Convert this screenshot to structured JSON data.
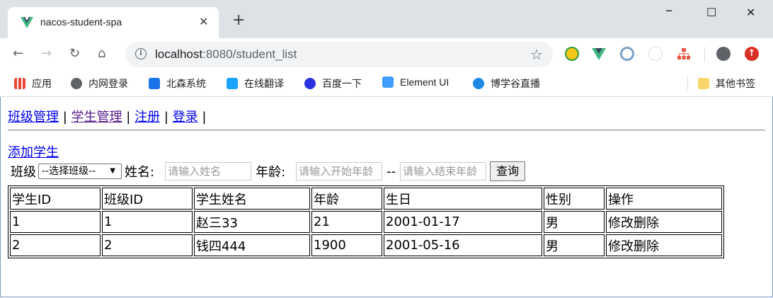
{
  "browser": {
    "tab_title": "nacos-student-spa",
    "url_host": "localhost",
    "url_rest": ":8080/student_list",
    "bookmarks": [
      "应用",
      "内网登录",
      "北森系统",
      "在线翻译",
      "百度一下",
      "Element UI",
      "博学谷直播"
    ],
    "other_bookmarks": "其他书签"
  },
  "nav": {
    "items": [
      "班级管理",
      "学生管理",
      "注册",
      "登录"
    ],
    "sep": "|"
  },
  "add_student": "添加学生",
  "filters": {
    "class_label": "班级",
    "class_select": "--选择班级--",
    "name_label": "姓名:",
    "name_placeholder": "请输入姓名",
    "age_label": "年龄:",
    "age_start_placeholder": "请输入开始年龄",
    "dash": "--",
    "age_end_placeholder": "请输入结束年龄",
    "query_button": "查询"
  },
  "table": {
    "headers": [
      "学生ID",
      "班级ID",
      "学生姓名",
      "年龄",
      "生日",
      "性别",
      "操作"
    ],
    "rows": [
      [
        "1",
        "1",
        "赵三33",
        "21",
        "2001-01-17",
        "男"
      ],
      [
        "2",
        "2",
        "钱四444",
        "1900",
        "2001-05-16",
        "男"
      ]
    ],
    "edit": "修改",
    "delete": "删除"
  }
}
